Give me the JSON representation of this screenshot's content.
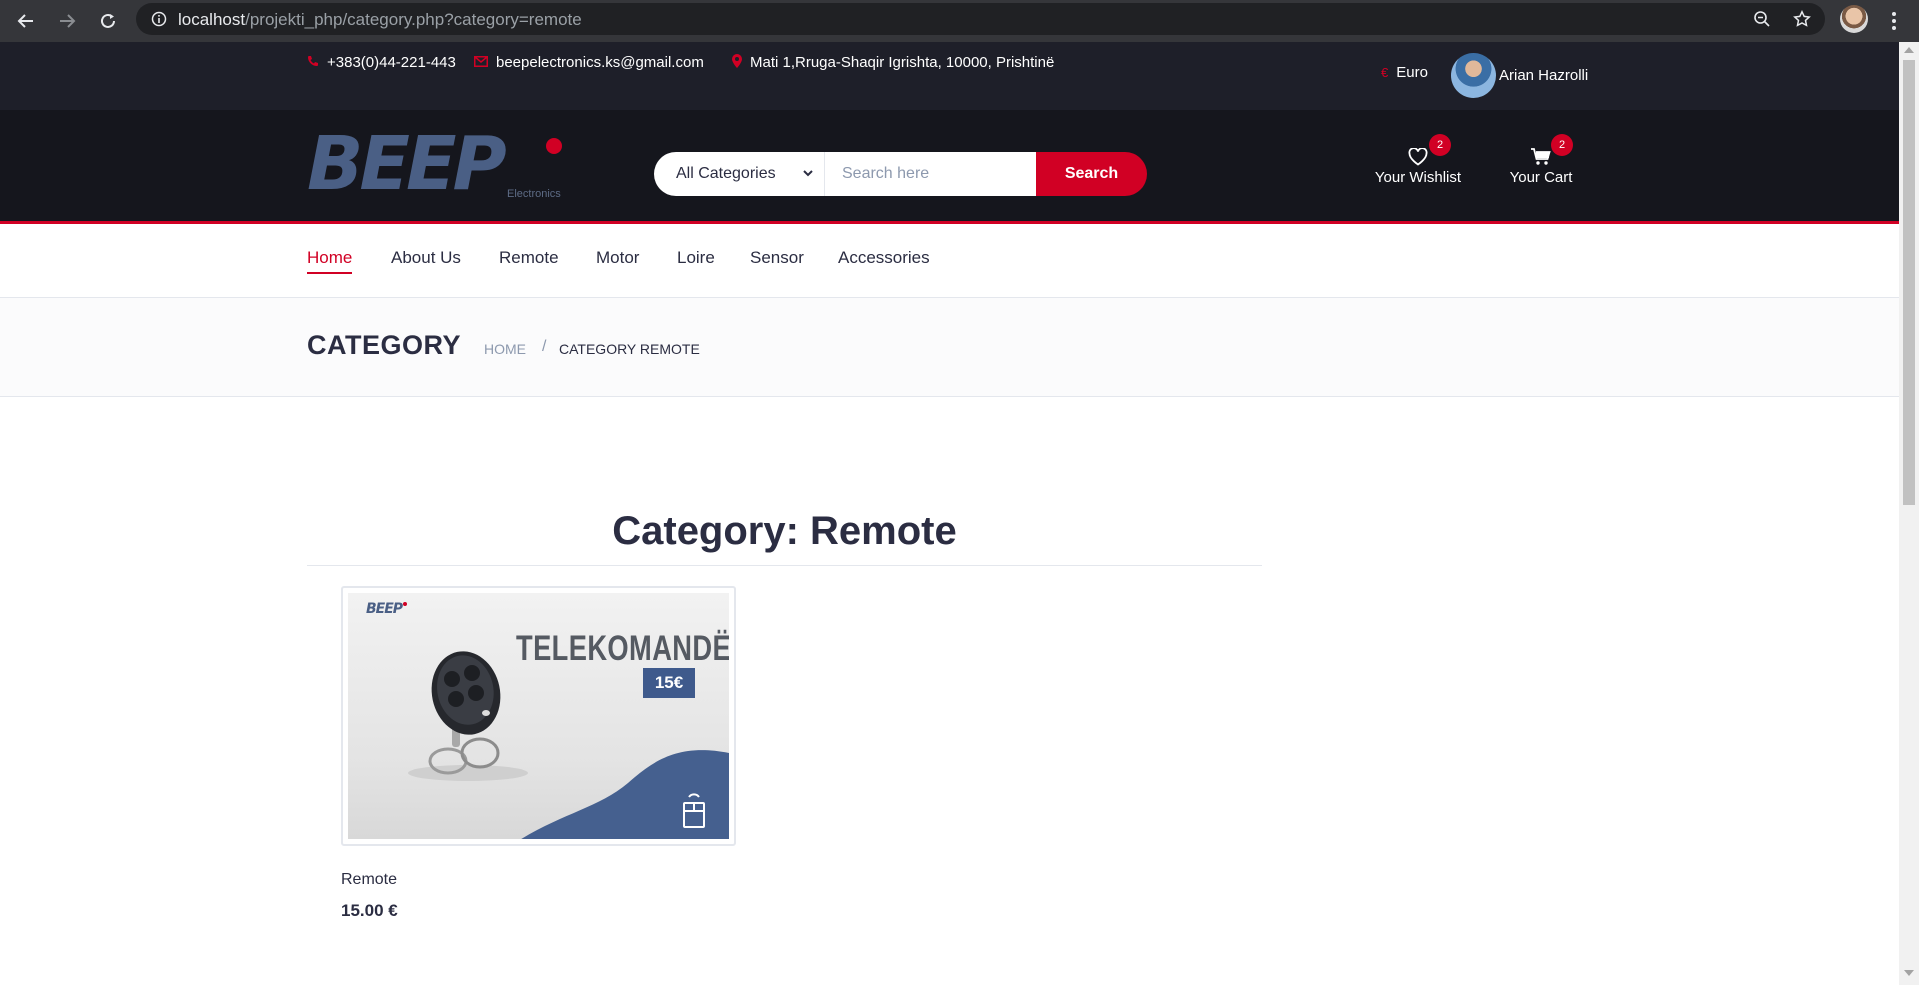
{
  "browser": {
    "url_host": "localhost",
    "url_path": "/projekti_php/category.php?category=remote"
  },
  "top_header": {
    "phone": "+383(0)44-221-443",
    "email": "beepelectronics.ks@gmail.com",
    "address": "Mati 1,Rruga-Shaqir Igrishta, 10000, Prishtinë",
    "currency_symbol": "€",
    "currency": "Euro",
    "user_name": "Arian Hazrolli"
  },
  "logo": {
    "word": "BEEP",
    "sub": "Electronics"
  },
  "search": {
    "category_selected": "All Categories",
    "placeholder": "Search here",
    "button": "Search"
  },
  "wishlist": {
    "label": "Your Wishlist",
    "count": "2"
  },
  "cart": {
    "label": "Your Cart",
    "count": "2"
  },
  "nav": {
    "items": [
      "Home",
      "About Us",
      "Remote",
      "Motor",
      "Loire",
      "Sensor",
      "Accessories"
    ],
    "active": "Home"
  },
  "breadcrumb": {
    "title": "CATEGORY",
    "home": "HOME",
    "separator": "/",
    "current": "CATEGORY REMOTE"
  },
  "section": {
    "title": "Category: Remote"
  },
  "products": [
    {
      "image_logo": "BEEP",
      "image_title": "TELEKOMANDË",
      "image_price": "15€",
      "name": "Remote",
      "price": "15.00 €"
    }
  ],
  "colors": {
    "accent": "#d10024",
    "header_dark": "#15161d",
    "top_header": "#1e1f29",
    "logo_blue": "#4a5f85"
  }
}
